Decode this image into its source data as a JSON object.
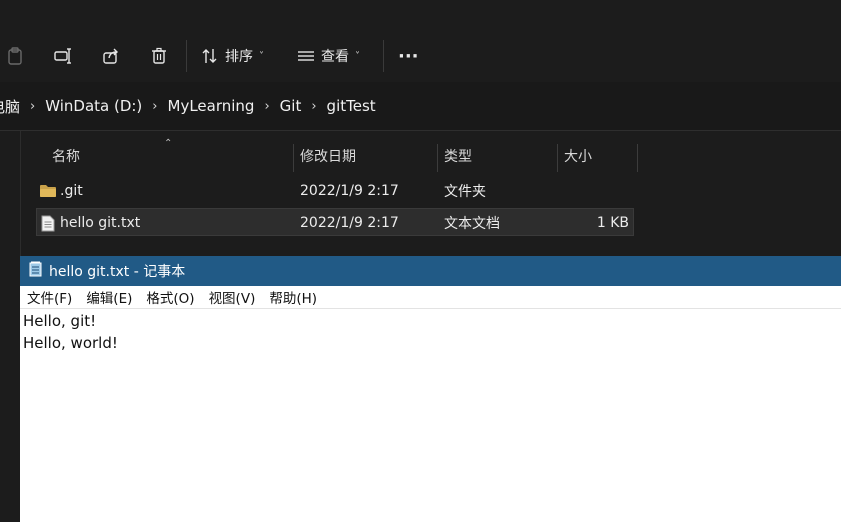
{
  "toolbar": {
    "sort_label": "排序",
    "view_label": "查看",
    "more_label": "···"
  },
  "address": {
    "crumbs": [
      "电脑",
      "WinData (D:)",
      "MyLearning",
      "Git",
      "gitTest"
    ]
  },
  "columns": {
    "name": "名称",
    "modified": "修改日期",
    "type": "类型",
    "size": "大小"
  },
  "files": [
    {
      "name": ".git",
      "modified": "2022/1/9 2:17",
      "type": "文件夹",
      "size": "",
      "icon": "folder-icon"
    },
    {
      "name": "hello git.txt",
      "modified": "2022/1/9 2:17",
      "type": "文本文档",
      "size": "1 KB",
      "icon": "text-file-icon"
    }
  ],
  "notepad": {
    "title": "hello git.txt - 记事本",
    "menu": [
      "文件(F)",
      "编辑(E)",
      "格式(O)",
      "视图(V)",
      "帮助(H)"
    ],
    "lines": [
      "Hello, git!",
      "Hello, world!"
    ]
  },
  "colors": {
    "notepad_titlebar": "#215a86",
    "explorer_bg": "#1c1c1c",
    "folder": "#c9a24a"
  }
}
